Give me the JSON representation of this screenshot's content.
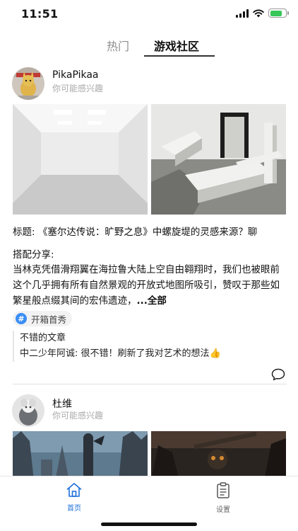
{
  "status": {
    "time": "11:51"
  },
  "tabs": [
    {
      "label": "热门",
      "active": false
    },
    {
      "label": "游戏社区",
      "active": true
    }
  ],
  "posts": [
    {
      "author": "PikaPikaa",
      "subtitle": "你可能感兴趣",
      "title": "标题: 《塞尔达传说：旷野之息》中螺旋堤的灵感来源？聊",
      "share_label": "搭配分享:",
      "share_text": "当林克凭借滑翔翼在海拉鲁大陆上空自由翱翔时，我们也被眼前这个几乎拥有所有自然景观的开放式地图所吸引，赞叹于那些如繁星般点缀其间的宏伟遗迹，",
      "more": "...全部",
      "tag": "开箱首秀",
      "comments": [
        "不错的文章",
        "中二少年阿诚: 很不错！刷新了我对艺术的想法👍"
      ]
    },
    {
      "author": "杜维",
      "subtitle": "你可能感兴趣"
    }
  ],
  "tabbar": {
    "home_label": "首页",
    "settings_label": "设置"
  },
  "colors": {
    "accent": "#1e6fd9",
    "tag_icon": "#3a8df7"
  }
}
